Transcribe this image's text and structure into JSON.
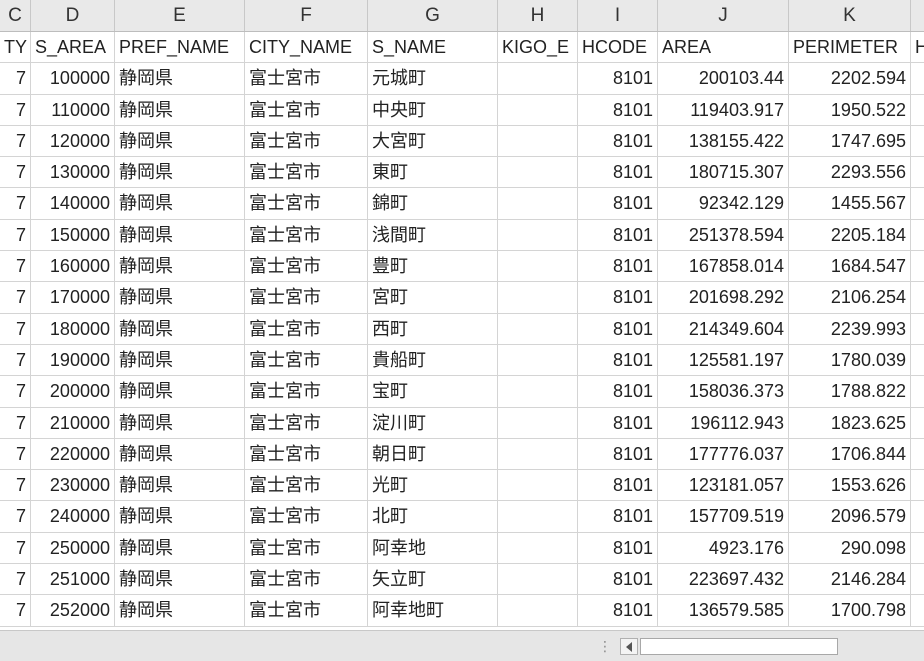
{
  "column_letters": [
    "C",
    "D",
    "E",
    "F",
    "G",
    "H",
    "I",
    "J",
    "K",
    ""
  ],
  "headers": [
    "TY",
    "S_AREA",
    "PREF_NAME",
    "CITY_NAME",
    "S_NAME",
    "KIGO_E",
    "HCODE",
    "AREA",
    "PERIMETER",
    "H"
  ],
  "rows": [
    [
      "7",
      "100000",
      "静岡県",
      "富士宮市",
      "元城町",
      "",
      "8101",
      "200103.44",
      "2202.594",
      ""
    ],
    [
      "7",
      "110000",
      "静岡県",
      "富士宮市",
      "中央町",
      "",
      "8101",
      "119403.917",
      "1950.522",
      ""
    ],
    [
      "7",
      "120000",
      "静岡県",
      "富士宮市",
      "大宮町",
      "",
      "8101",
      "138155.422",
      "1747.695",
      ""
    ],
    [
      "7",
      "130000",
      "静岡県",
      "富士宮市",
      "東町",
      "",
      "8101",
      "180715.307",
      "2293.556",
      ""
    ],
    [
      "7",
      "140000",
      "静岡県",
      "富士宮市",
      "錦町",
      "",
      "8101",
      "92342.129",
      "1455.567",
      ""
    ],
    [
      "7",
      "150000",
      "静岡県",
      "富士宮市",
      "浅間町",
      "",
      "8101",
      "251378.594",
      "2205.184",
      ""
    ],
    [
      "7",
      "160000",
      "静岡県",
      "富士宮市",
      "豊町",
      "",
      "8101",
      "167858.014",
      "1684.547",
      ""
    ],
    [
      "7",
      "170000",
      "静岡県",
      "富士宮市",
      "宮町",
      "",
      "8101",
      "201698.292",
      "2106.254",
      ""
    ],
    [
      "7",
      "180000",
      "静岡県",
      "富士宮市",
      "西町",
      "",
      "8101",
      "214349.604",
      "2239.993",
      ""
    ],
    [
      "7",
      "190000",
      "静岡県",
      "富士宮市",
      "貴船町",
      "",
      "8101",
      "125581.197",
      "1780.039",
      ""
    ],
    [
      "7",
      "200000",
      "静岡県",
      "富士宮市",
      "宝町",
      "",
      "8101",
      "158036.373",
      "1788.822",
      ""
    ],
    [
      "7",
      "210000",
      "静岡県",
      "富士宮市",
      "淀川町",
      "",
      "8101",
      "196112.943",
      "1823.625",
      ""
    ],
    [
      "7",
      "220000",
      "静岡県",
      "富士宮市",
      "朝日町",
      "",
      "8101",
      "177776.037",
      "1706.844",
      ""
    ],
    [
      "7",
      "230000",
      "静岡県",
      "富士宮市",
      "光町",
      "",
      "8101",
      "123181.057",
      "1553.626",
      ""
    ],
    [
      "7",
      "240000",
      "静岡県",
      "富士宮市",
      "北町",
      "",
      "8101",
      "157709.519",
      "2096.579",
      ""
    ],
    [
      "7",
      "250000",
      "静岡県",
      "富士宮市",
      "阿幸地",
      "",
      "8101",
      "4923.176",
      "290.098",
      ""
    ],
    [
      "7",
      "251000",
      "静岡県",
      "富士宮市",
      "矢立町",
      "",
      "8101",
      "223697.432",
      "2146.284",
      ""
    ],
    [
      "7",
      "252000",
      "静岡県",
      "富士宮市",
      "阿幸地町",
      "",
      "8101",
      "136579.585",
      "1700.798",
      ""
    ]
  ],
  "numeric_columns": [
    0,
    1,
    6,
    7,
    8
  ],
  "scrollbar": {
    "grip_glyph": "⋮"
  }
}
